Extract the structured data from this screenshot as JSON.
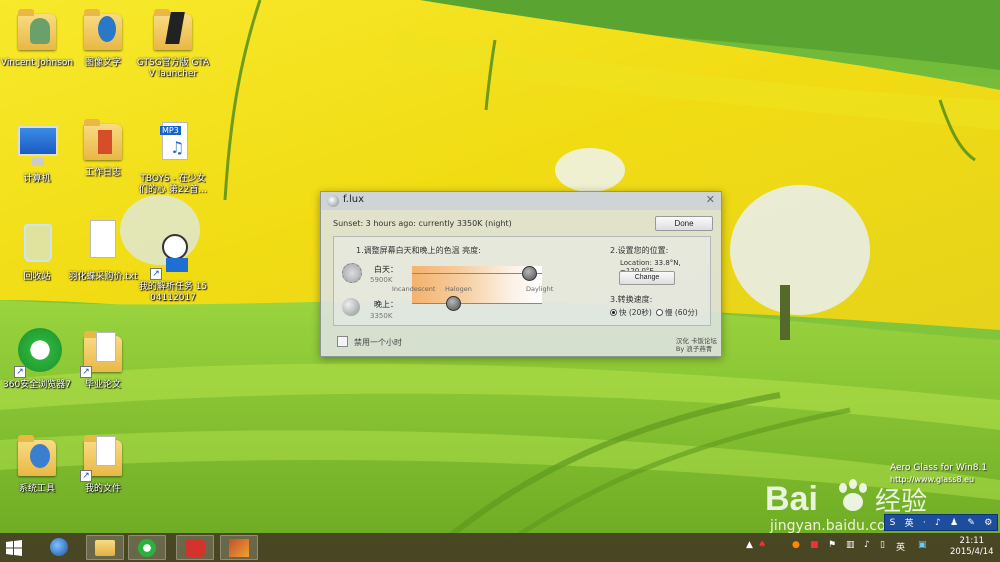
{
  "desktop": {
    "icons": [
      {
        "label": "Vincent Johnson"
      },
      {
        "label": "图像文字"
      },
      {
        "label": "GTSG官方版 GTAV launcher"
      },
      {
        "label": "计算机"
      },
      {
        "label": "工作日志"
      },
      {
        "label": "TBOYS - 在少女们的心 第22首..."
      },
      {
        "label": "回收站"
      },
      {
        "label": "羽化蝶采购价.txt"
      },
      {
        "label": "我的解析任务 1504112017"
      },
      {
        "label": "360安全浏览器7"
      },
      {
        "label": "毕业论文"
      },
      {
        "label": "系统工具"
      },
      {
        "label": "我的文件"
      }
    ],
    "mp3_badge": "MP3"
  },
  "flux": {
    "title": "f.lux",
    "close": "✕",
    "sunset_text": "Sunset: 3 hours ago: currently 3350K (night)",
    "done_label": "Done",
    "section1": "1.调整屏幕白天和晚上的色温 亮度:",
    "day_label": "白天：",
    "day_value": "5900K",
    "night_label": "晚上：",
    "night_value": "3350K",
    "marks": {
      "incandescent": "Incandescent",
      "halogen": "Halogen",
      "daylight": "Daylight"
    },
    "day_level": 0.9,
    "night_level": 0.32,
    "section2": "2.设置您的位置:",
    "location": "Location: 33.8°N, ~120.0°E",
    "change_label": "Change",
    "section3": "3.转换速度:",
    "speed_fast": "快 (20秒)",
    "speed_slow": "慢 (60分)",
    "disable_label": "禁用一个小时",
    "credit_line1": "汉化 卡饭论坛",
    "credit_line2": "By   浪子燕青"
  },
  "watermark": {
    "aero_line1": "Aero Glass for Win8.1",
    "aero_line2": "http://www.glass8.eu",
    "baidu_text": "Bai 经验",
    "baidu_url": "jingyan.baidu.com"
  },
  "ime": {
    "items": [
      "S",
      "英",
      "·",
      "♪",
      "♟",
      "✎",
      "⚙"
    ]
  },
  "taskbar": {
    "tray_lang": "英",
    "time": "21:11",
    "date": "2015/4/14"
  },
  "colors": {
    "taskbar": "#463e24",
    "ime": "#1d4e9e",
    "grass": "#7cbf2a",
    "rapeseed": "#f2e21e"
  }
}
